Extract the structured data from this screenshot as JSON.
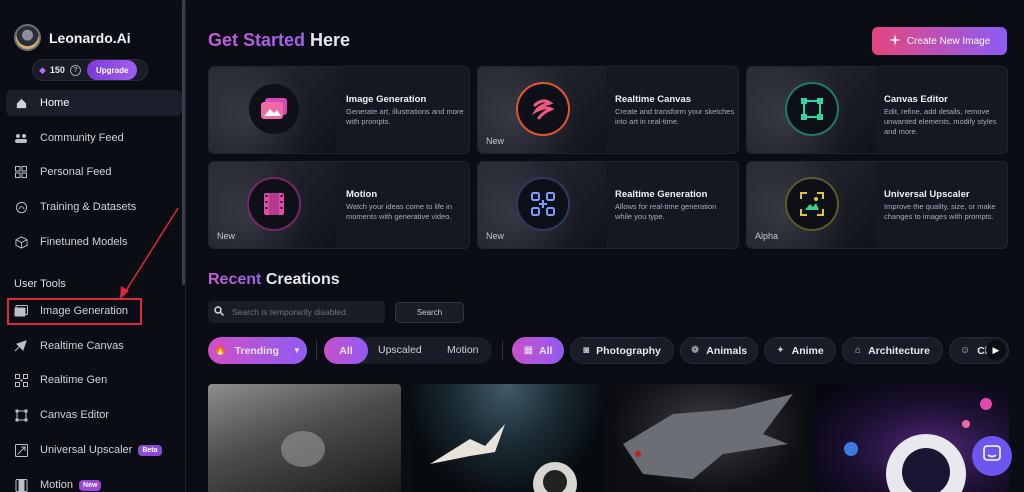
{
  "brand": {
    "name": "Leonardo.Ai"
  },
  "credits": {
    "count": "150",
    "help": "?",
    "upgrade_label": "Upgrade"
  },
  "sidebar": {
    "items": [
      {
        "label": "Home",
        "icon": "home-icon"
      },
      {
        "label": "Community Feed",
        "icon": "community-icon"
      },
      {
        "label": "Personal Feed",
        "icon": "grid-icon"
      },
      {
        "label": "Training & Datasets",
        "icon": "training-icon"
      },
      {
        "label": "Finetuned Models",
        "icon": "cube-icon"
      }
    ],
    "section_title": "User Tools",
    "tools": [
      {
        "label": "Image Generation",
        "icon": "image-icon"
      },
      {
        "label": "Realtime Canvas",
        "icon": "brush-icon"
      },
      {
        "label": "Realtime Gen",
        "icon": "grid-dots-icon"
      },
      {
        "label": "Canvas Editor",
        "icon": "canvas-icon"
      },
      {
        "label": "Universal Upscaler",
        "icon": "upscale-icon",
        "badge": "Beta"
      },
      {
        "label": "Motion",
        "icon": "film-icon",
        "badge": "New"
      }
    ]
  },
  "header": {
    "title_accent": "Get Started",
    "title_rest": "Here",
    "create_label": "Create New Image"
  },
  "cards": [
    {
      "title": "Image Generation",
      "desc": "Generate art, illustrations and more with prompts.",
      "tag": ""
    },
    {
      "title": "Realtime Canvas",
      "desc": "Create and transform your sketches into art in real-time.",
      "tag": "New"
    },
    {
      "title": "Canvas Editor",
      "desc": "Edit, refine, add details, remove unwanted elements, modify styles and more.",
      "tag": ""
    },
    {
      "title": "Motion",
      "desc": "Watch your ideas come to life in moments with generative video.",
      "tag": "New"
    },
    {
      "title": "Realtime Generation",
      "desc": "Allows for real-time generation while you type.",
      "tag": "New"
    },
    {
      "title": "Universal Upscaler",
      "desc": "Improve the quality, size, or make changes to images with prompts.",
      "tag": "Alpha"
    }
  ],
  "recent": {
    "title_accent": "Recent",
    "title_rest": "Creations",
    "search_placeholder": "Search is temporarily disabled.",
    "search_button": "Search"
  },
  "filters": {
    "sort": "Trending",
    "media": [
      "All",
      "Upscaled",
      "Motion"
    ],
    "categories": [
      "All",
      "Photography",
      "Animals",
      "Anime",
      "Architecture",
      "Ch"
    ]
  },
  "colors": {
    "accent": "#a35df0",
    "pink": "#e6457e",
    "bg": "#0b0d14",
    "card": "#151823",
    "highlight": "#e0263d"
  }
}
